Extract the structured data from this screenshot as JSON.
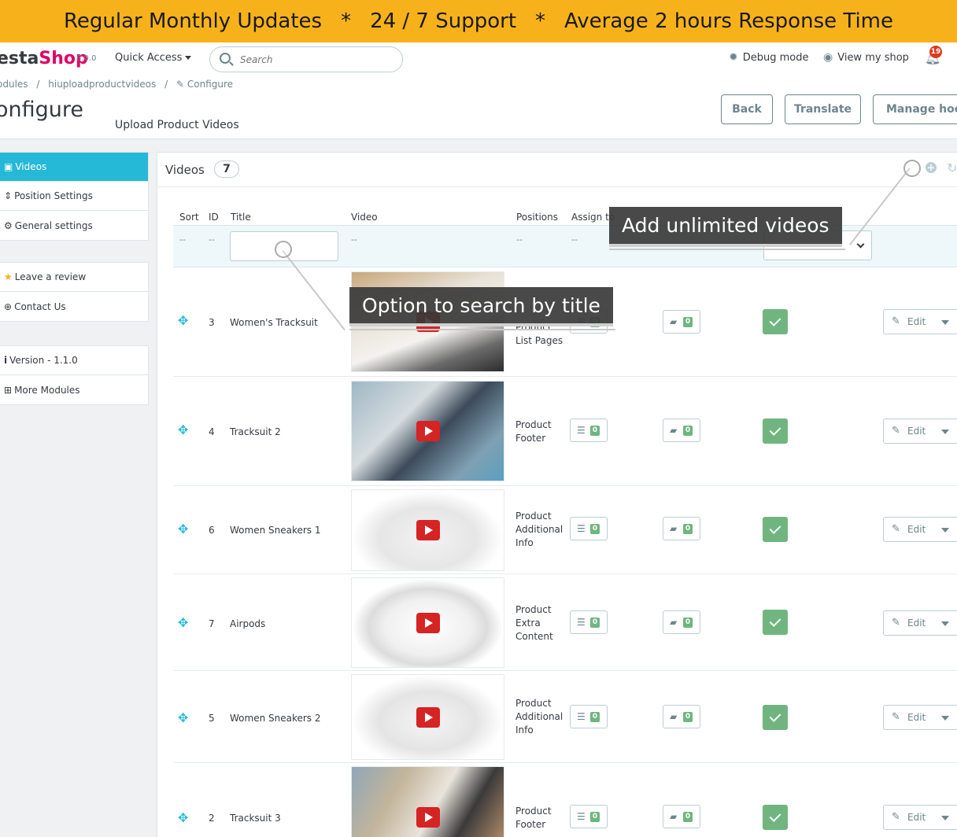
{
  "banner": {
    "item1": "Regular Monthly Updates",
    "sep": "*",
    "item2": "24 / 7 Support",
    "item3": "Average 2 hours Response Time"
  },
  "topnav": {
    "logo_pre": "esta",
    "logo_shop": "Shop",
    "version": "8.0.0",
    "quick_access": "Quick Access",
    "search_placeholder": "Search",
    "debug_mode": "Debug mode",
    "view_shop": "View my shop",
    "notifications": "19"
  },
  "breadcrumb": [
    "odules",
    "/",
    "hiuploadproductvideos",
    "/",
    "Configure"
  ],
  "header": {
    "title": "onfigure",
    "subtitle": "Upload Product Videos",
    "back": "Back",
    "translate": "Translate",
    "manage_hooks": "Manage hooks"
  },
  "sidebar": {
    "group1": [
      "Videos",
      "Position Settings",
      "General settings"
    ],
    "group2": [
      "Leave a review",
      "Contact Us"
    ],
    "group3": [
      "Version - 1.1.0",
      "More Modules"
    ]
  },
  "panel": {
    "title": "Videos",
    "count": "7"
  },
  "table": {
    "headers": [
      "Sort",
      "ID",
      "Title",
      "Video",
      "Positions",
      "Assign to"
    ],
    "filter_dash": "--",
    "rows": [
      {
        "id": "3",
        "title": "Women's Tracksuit",
        "positions": "Product List Pages",
        "assign": "0",
        "cat": "0"
      },
      {
        "id": "4",
        "title": "Tracksuit 2",
        "positions": "Product Footer",
        "assign": "0",
        "cat": "0"
      },
      {
        "id": "6",
        "title": "Women Sneakers 1",
        "positions": "Product Additional Info",
        "assign": "0",
        "cat": "0"
      },
      {
        "id": "7",
        "title": "Airpods",
        "positions": "Product Extra Content",
        "assign": "0",
        "cat": "0"
      },
      {
        "id": "5",
        "title": "Women Sneakers 2",
        "positions": "Product Additional Info",
        "assign": "0",
        "cat": "0"
      },
      {
        "id": "2",
        "title": "Tracksuit 3",
        "positions": "Product Footer",
        "assign": "0",
        "cat": "0"
      }
    ],
    "edit": "Edit"
  },
  "annotations": {
    "add": "Add unlimited videos",
    "search": "Option to search by title"
  }
}
